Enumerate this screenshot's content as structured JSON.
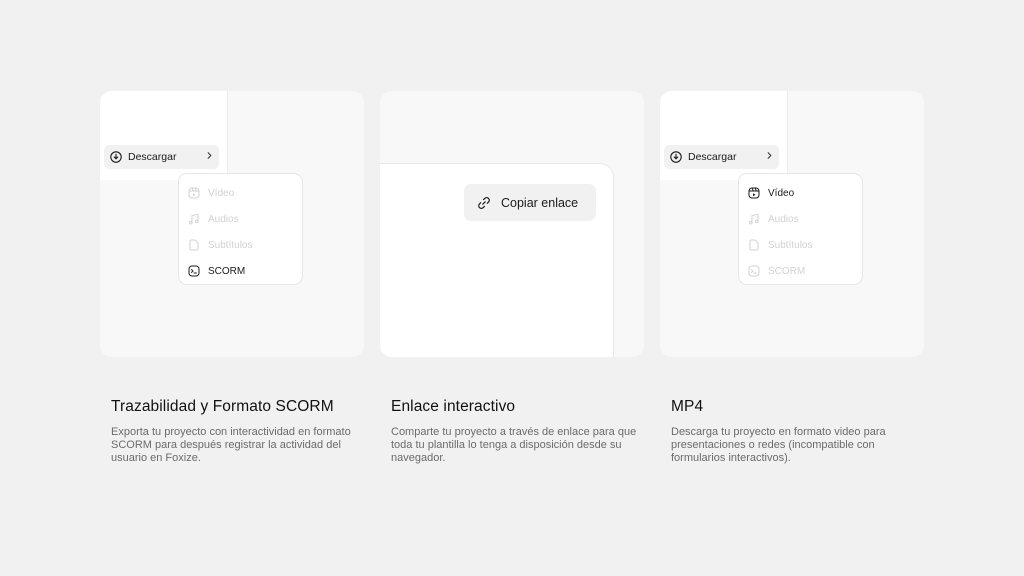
{
  "cards": {
    "scorm": {
      "download_label": "Descargar",
      "menu_items": [
        "Vídeo",
        "Audios",
        "Subtítulos",
        "SCORM"
      ],
      "active_item": "SCORM",
      "title": "Trazabilidad y Formato SCORM",
      "description": "Exporta tu proyecto con interactividad en formato SCORM para después registrar la actividad del usuario en Foxize."
    },
    "link": {
      "copy_label": "Copiar enlace",
      "title": "Enlace interactivo",
      "description": "Comparte tu proyecto a través de enlace para que toda tu plantilla lo tenga a disposición desde su navegador."
    },
    "mp4": {
      "download_label": "Descargar",
      "menu_items": [
        "Vídeo",
        "Audios",
        "Subtítulos",
        "SCORM"
      ],
      "active_item": "Vídeo",
      "title": "MP4",
      "description": "Descarga tu proyecto en formato video para presentaciones o redes (incompatible con formularios interactivos)."
    }
  },
  "icons": {
    "download": "download-icon",
    "chevron": "chevron-right-icon",
    "video": "video-icon",
    "audio": "music-note-icon",
    "subtitles": "subtitles-icon",
    "scorm": "scorm-icon",
    "link": "link-icon"
  },
  "colors": {
    "background": "#f1f1f1",
    "card": "#f8f8f8",
    "active_text": "#1a1a1a",
    "disabled_text": "#d2d2d2",
    "description_text": "#6b6b6b"
  }
}
